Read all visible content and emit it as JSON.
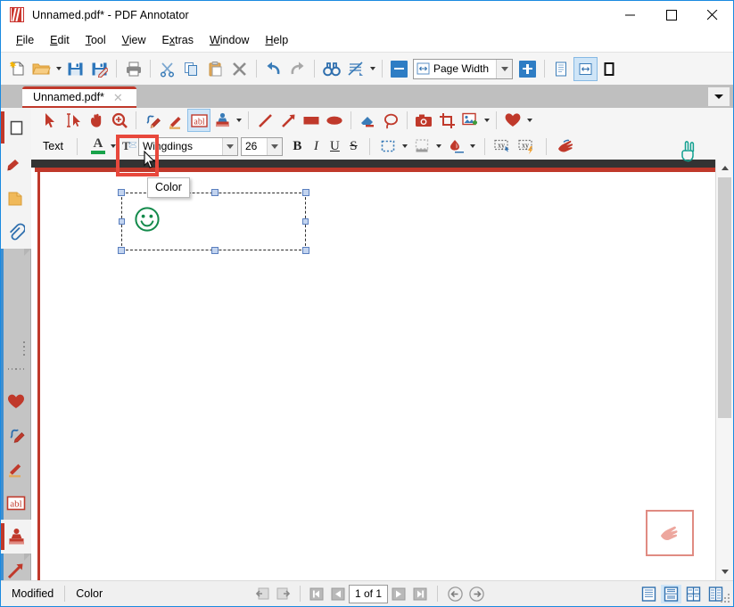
{
  "window": {
    "title": "Unnamed.pdf* - PDF Annotator",
    "logo_icon": "pdf-annotator-logo-icon",
    "minimize_icon": "minimize-icon",
    "maximize_icon": "maximize-icon",
    "close_icon": "close-icon"
  },
  "menubar": {
    "items": [
      {
        "label": "File",
        "accel": "F"
      },
      {
        "label": "Edit",
        "accel": "E"
      },
      {
        "label": "Tool",
        "accel": "T"
      },
      {
        "label": "View",
        "accel": "V"
      },
      {
        "label": "Extras",
        "accel": "x"
      },
      {
        "label": "Window",
        "accel": "W"
      },
      {
        "label": "Help",
        "accel": "H"
      }
    ]
  },
  "main_toolbar": {
    "buttons": [
      {
        "name": "new-document",
        "icon": "new-page-icon"
      },
      {
        "name": "open-document",
        "icon": "open-folder-icon",
        "has_dropdown": true
      },
      {
        "name": "save-document",
        "icon": "save-disk-icon"
      },
      {
        "name": "save-as-document",
        "icon": "save-as-disk-icon"
      },
      {
        "name": "print-document",
        "icon": "printer-icon"
      },
      {
        "name": "cut",
        "icon": "scissors-icon"
      },
      {
        "name": "copy",
        "icon": "copy-icon"
      },
      {
        "name": "paste",
        "icon": "paste-clipboard-icon"
      },
      {
        "name": "delete",
        "icon": "delete-x-icon"
      },
      {
        "name": "undo",
        "icon": "undo-arrow-icon"
      },
      {
        "name": "redo",
        "icon": "redo-arrow-icon"
      },
      {
        "name": "find",
        "icon": "binoculars-icon"
      },
      {
        "name": "erase-all",
        "icon": "clear-annotations-icon",
        "has_dropdown": true
      },
      {
        "name": "zoom-out",
        "icon": "minus-icon"
      }
    ],
    "zoom_value": "Page Width",
    "zoom_icon": "page-width-icon",
    "zoom_in_icon": "plus-icon",
    "view_buttons": [
      {
        "name": "single-page-view",
        "icon": "single-page-icon",
        "selected": false
      },
      {
        "name": "fit-page-width-view",
        "icon": "page-width-view-icon",
        "selected": true
      },
      {
        "name": "fullscreen-view",
        "icon": "fullscreen-icon",
        "selected": false
      }
    ]
  },
  "tabstrip": {
    "tab_label": "Unnamed.pdf*",
    "close_icon": "close-tab-icon",
    "overflow_icon": "chevron-down-icon"
  },
  "tool_toolbar": {
    "buttons": [
      {
        "name": "select-tool",
        "icon": "arrow-pointer-icon",
        "selected": false
      },
      {
        "name": "text-select-tool",
        "icon": "text-select-icon",
        "selected": false
      },
      {
        "name": "pan-tool",
        "icon": "hand-icon",
        "selected": false
      },
      {
        "name": "zoom-tool",
        "icon": "magnifier-plus-icon",
        "selected": false
      },
      {
        "name": "pen-tool",
        "icon": "blue-pen-icon",
        "selected": false
      },
      {
        "name": "highlighter-tool",
        "icon": "highlighter-pencil-icon",
        "selected": false
      },
      {
        "name": "text-tool",
        "icon": "abl-text-icon",
        "selected": true
      },
      {
        "name": "stamp-tool",
        "icon": "stamp-icon",
        "selected": false,
        "has_dropdown": true
      },
      {
        "name": "line-tool",
        "icon": "line-icon",
        "selected": false
      },
      {
        "name": "arrow-tool",
        "icon": "arrow-shape-icon",
        "selected": false
      },
      {
        "name": "rectangle-tool",
        "icon": "rectangle-icon",
        "selected": false
      },
      {
        "name": "ellipse-tool",
        "icon": "ellipse-icon",
        "selected": false
      },
      {
        "name": "eraser-tool",
        "icon": "eraser-icon",
        "selected": false
      },
      {
        "name": "lasso-tool",
        "icon": "lasso-icon",
        "selected": false
      },
      {
        "name": "snapshot-tool",
        "icon": "camera-icon",
        "selected": false
      },
      {
        "name": "crop-tool",
        "icon": "crop-icon",
        "selected": false
      },
      {
        "name": "insert-image-tool",
        "icon": "add-image-icon",
        "selected": false,
        "has_dropdown": true
      },
      {
        "name": "favorites-tool",
        "icon": "heart-icon",
        "selected": false,
        "has_dropdown": true
      }
    ]
  },
  "format_toolbar": {
    "section_label": "Text",
    "color_button": {
      "name": "color-button",
      "icon": "font-color-a-icon",
      "swatch_color": "#18a34a",
      "tooltip": "Color",
      "highlighted": true,
      "highlight_color": "#e8483c"
    },
    "font_icon": "font-face-icon",
    "font_family": "Wingdings",
    "font_size": "26",
    "bold_label": "B",
    "italic_label": "I",
    "underline_label": "U",
    "strikethrough_label": "S",
    "extra_buttons": [
      {
        "name": "border-style-button",
        "icon": "dashed-border-icon",
        "has_dropdown": true
      },
      {
        "name": "fill-shade-button",
        "icon": "shading-icon",
        "has_dropdown": true
      },
      {
        "name": "fill-color-button",
        "icon": "ink-drop-icon",
        "has_dropdown": true
      },
      {
        "name": "insert-field-button",
        "icon": "xy-field-icon"
      },
      {
        "name": "auto-field-button",
        "icon": "xy-lightning-icon"
      },
      {
        "name": "pan-shortcut-button",
        "icon": "red-hand-icon"
      }
    ]
  },
  "left_dock": {
    "items": [
      {
        "name": "sidebar-item-thumbnails",
        "icon": "page-outline-icon",
        "active": true
      },
      {
        "name": "sidebar-item-bookmarks",
        "icon": "red-bookmark-icon",
        "active": false
      },
      {
        "name": "sidebar-item-pages",
        "icon": "yellow-page-icon",
        "active": false
      },
      {
        "name": "sidebar-item-attachments",
        "icon": "paperclip-icon",
        "active": false
      },
      {
        "name": "sidebar-item-favorites",
        "icon": "heart-icon",
        "active": false
      },
      {
        "name": "sidebar-item-pen",
        "icon": "blue-pen-icon",
        "active": false
      },
      {
        "name": "sidebar-item-highlighter",
        "icon": "highlighter-pencil-icon",
        "active": false
      },
      {
        "name": "sidebar-item-text",
        "icon": "abl-text-icon",
        "active": false
      },
      {
        "name": "sidebar-item-stamp",
        "icon": "stamp-icon",
        "active": true
      },
      {
        "name": "sidebar-item-arrow",
        "icon": "arrow-shape-icon",
        "active": false
      }
    ]
  },
  "document": {
    "annotation": {
      "name": "smiley-annotation",
      "glyph": "smiley-face-icon",
      "color": "#138a4b",
      "selected": true,
      "handle_count": 8
    },
    "top_right_marker": {
      "name": "victory-hand-glyph",
      "icon": "victory-hand-icon",
      "color": "#0f9b8e"
    },
    "bottom_right_box": {
      "name": "pan-hand-marker",
      "icon": "hand-pointer-icon",
      "border_color": "#e08b82"
    },
    "scrollbar": {
      "up_icon": "chevron-up-icon",
      "down_icon": "chevron-down-icon"
    }
  },
  "statusbar": {
    "status": "Modified",
    "hint": "Color",
    "nav_buttons": [
      {
        "name": "go-back-button",
        "icon": "back-page-icon"
      },
      {
        "name": "go-forward-button",
        "icon": "forward-page-icon"
      },
      {
        "name": "first-page-button",
        "icon": "first-page-icon"
      },
      {
        "name": "previous-page-button",
        "icon": "previous-page-icon"
      }
    ],
    "page_indicator": "1 of 1",
    "nav_buttons_right": [
      {
        "name": "next-page-button",
        "icon": "next-page-icon"
      },
      {
        "name": "last-page-button",
        "icon": "last-page-icon"
      },
      {
        "name": "history-back-button",
        "icon": "history-back-icon"
      },
      {
        "name": "history-forward-button",
        "icon": "history-forward-icon"
      }
    ],
    "layout_buttons": [
      {
        "name": "layout-single-button",
        "icon": "layout-single-icon",
        "selected": false
      },
      {
        "name": "layout-continuous-button",
        "icon": "layout-continuous-icon",
        "selected": true
      },
      {
        "name": "layout-facing-button",
        "icon": "layout-facing-icon",
        "selected": false
      },
      {
        "name": "layout-grid-button",
        "icon": "layout-grid-icon",
        "selected": false
      }
    ],
    "resize_grip_icon": "resize-grip-icon"
  }
}
